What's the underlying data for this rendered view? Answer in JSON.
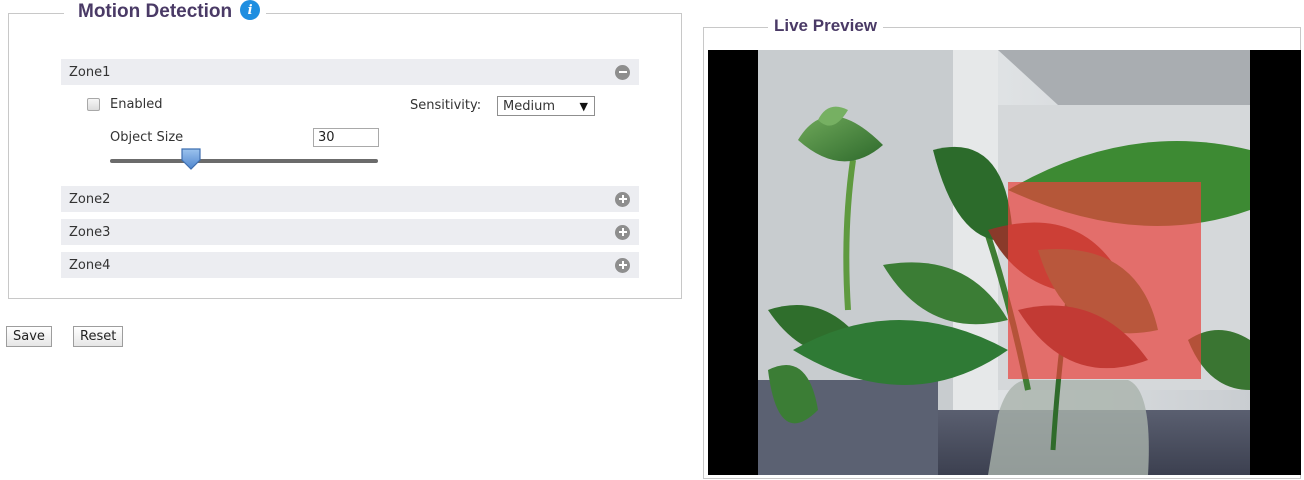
{
  "motion_detection": {
    "title": "Motion Detection",
    "info_icon": "i",
    "zones": [
      {
        "label": "Zone1",
        "state": "expanded"
      },
      {
        "label": "Zone2",
        "state": "collapsed"
      },
      {
        "label": "Zone3",
        "state": "collapsed"
      },
      {
        "label": "Zone4",
        "state": "collapsed"
      }
    ],
    "zone1": {
      "enabled_label": "Enabled",
      "enabled": false,
      "object_size_label": "Object Size",
      "object_size_value": "30",
      "sensitivity_label": "Sensitivity:",
      "sensitivity_value": "Medium",
      "sensitivity_arrow": "▼"
    }
  },
  "actions": {
    "save_label": "Save",
    "reset_label": "Reset"
  },
  "live_preview": {
    "title": "Live Preview",
    "detection_overlay_color": "#e8413c"
  },
  "colors": {
    "legend_text": "#4a3a66",
    "zone_row_bg": "#ecedf1",
    "info_icon": "#1e8ee0",
    "slider_handle": "#6aa0dd"
  },
  "icons": {
    "zone1_toggle": "collapse-icon",
    "zone_other_toggle": "expand-icon",
    "info": "info-icon"
  }
}
